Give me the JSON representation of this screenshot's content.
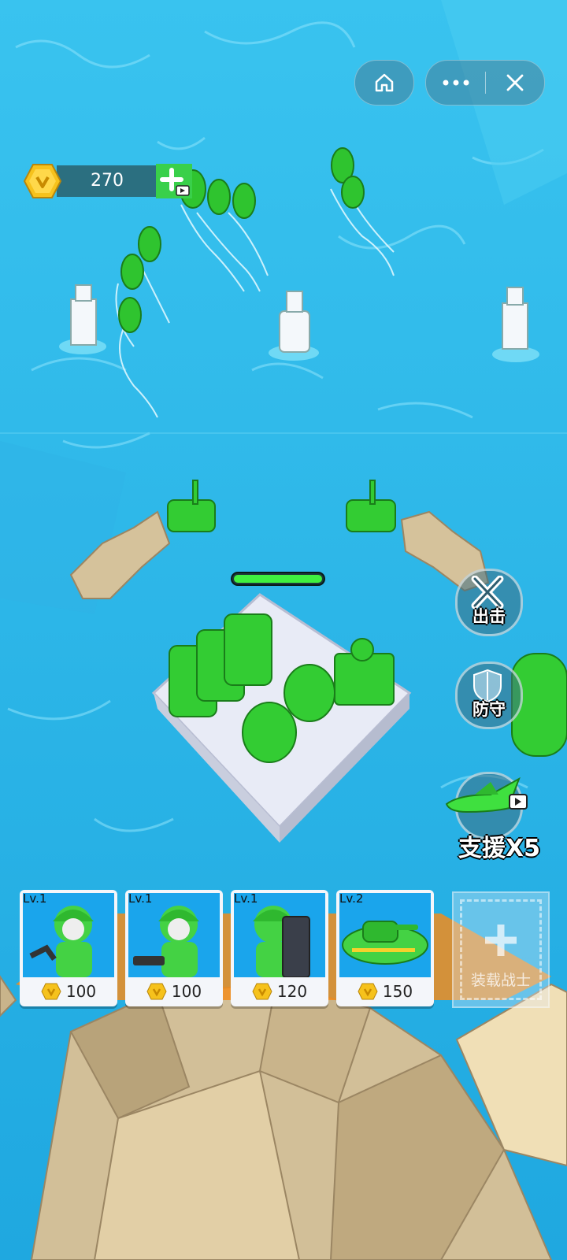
{
  "colors": {
    "sea": "#29b6e6",
    "sea_light": "#6fd9f5",
    "army_green": "#33cc33",
    "rock": "#c8b48c",
    "gold": "#f6c21c"
  },
  "top_bar": {
    "home_icon": "home-icon",
    "more_icon": "more-dots-icon",
    "close_icon": "close-icon"
  },
  "currency": {
    "icon": "gold-coin-icon",
    "value": "270",
    "add_icon": "plus-video-icon"
  },
  "base": {
    "health_fraction": 1.0
  },
  "actions": {
    "attack": {
      "label": "出击",
      "icon": "crossed-swords-icon"
    },
    "defend": {
      "label": "防守",
      "icon": "shield-icon"
    },
    "support": {
      "label": "支援",
      "count": "X5",
      "icon": "jet-plane-icon"
    }
  },
  "units": [
    {
      "level": "Lv.1",
      "price": "100",
      "icon": "soldier-wrench-icon"
    },
    {
      "level": "Lv.1",
      "price": "100",
      "icon": "soldier-gun-icon"
    },
    {
      "level": "Lv.1",
      "price": "120",
      "icon": "soldier-shield-icon"
    },
    {
      "level": "Lv.2",
      "price": "150",
      "icon": "tank-boat-icon"
    }
  ],
  "add_slot": {
    "label": "装载战士",
    "icon": "plus-icon"
  }
}
